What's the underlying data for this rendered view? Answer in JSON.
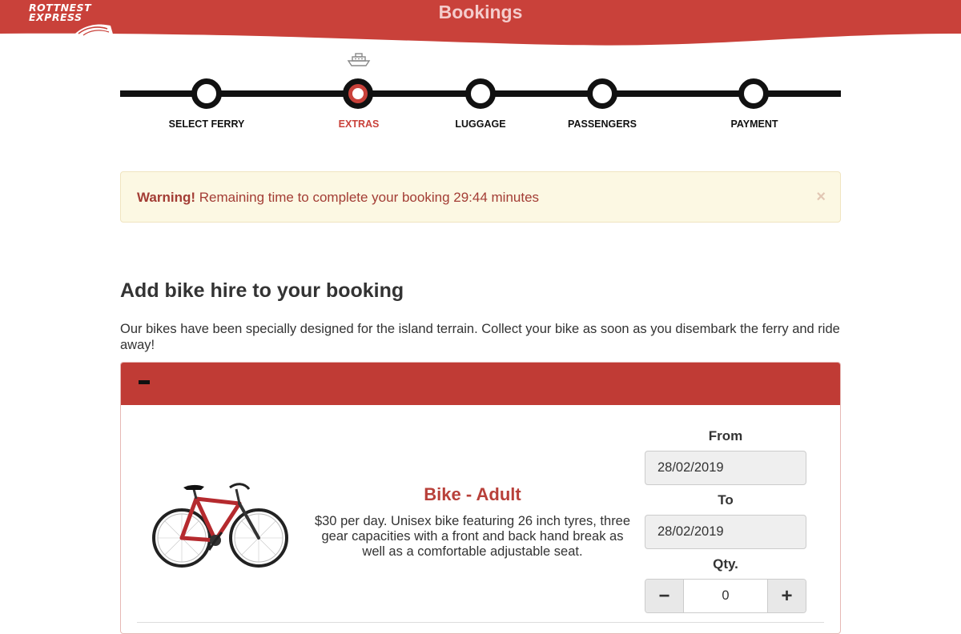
{
  "header": {
    "logo_line1": "ROTTNEST",
    "logo_line2": "EXPRESS",
    "title": "Bookings",
    "brand_color": "#c9413a"
  },
  "stepper": {
    "steps": [
      {
        "label": "SELECT FERRY",
        "active": false
      },
      {
        "label": "EXTRAS",
        "active": true
      },
      {
        "label": "LUGGAGE",
        "active": false
      },
      {
        "label": "PASSENGERS",
        "active": false
      },
      {
        "label": "PAYMENT",
        "active": false
      }
    ],
    "active_icon": "ferry-icon"
  },
  "alert": {
    "strong": "Warning!",
    "message": " Remaining time to complete your booking 29:44 minutes",
    "close_label": "×"
  },
  "section": {
    "title": "Add bike hire to your booking",
    "intro": "Our bikes have been specially designed for the island terrain. Collect your bike as soon as you disembark the ferry and ride away!",
    "collapse_icon": "minus-icon"
  },
  "product": {
    "name": "Bike - Adult",
    "description": "$30 per day. Unisex bike featuring 26 inch tyres, three gear capacities with a front and back hand break as well as a comfortable adjustable seat.",
    "image_icon": "bike-icon",
    "from_label": "From",
    "from_value": "28/02/2019",
    "to_label": "To",
    "to_value": "28/02/2019",
    "qty_label": "Qty.",
    "qty_value": "0",
    "minus_label": "−",
    "plus_label": "+"
  }
}
